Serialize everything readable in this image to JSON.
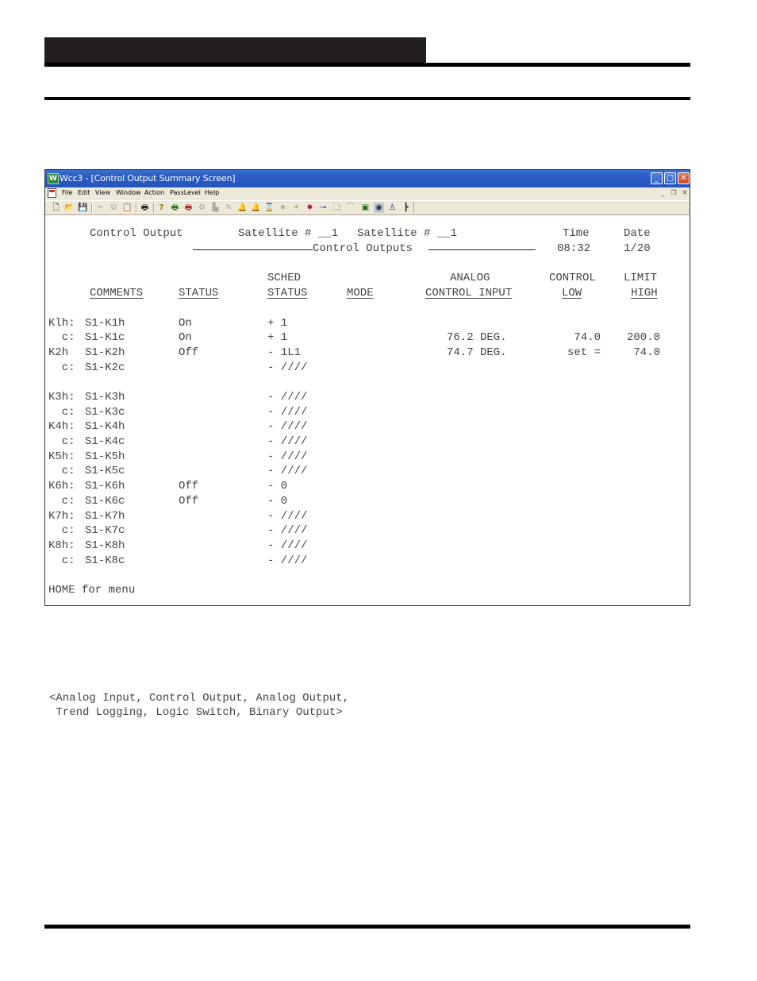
{
  "page": {
    "header_block_text": "",
    "note_lines": [
      "<Analog Input, Control Output, Analog Output,",
      " Trend Logging, Logic Switch, Binary Output>"
    ]
  },
  "window": {
    "title": "Wcc3 - [Control Output Summary Screen]",
    "app_icon": "W",
    "controls": {
      "minimize": "_",
      "maximize": "□",
      "close": "✕"
    },
    "menu": [
      "File",
      "Edit",
      "View",
      "Window",
      "Action",
      "PassLevel",
      "Help"
    ],
    "mdi_controls": {
      "minimize": "_",
      "restore": "❐",
      "close": "✕"
    },
    "toolbar": [
      {
        "name": "new-icon",
        "glyph": "🗋",
        "enabled": true
      },
      {
        "name": "open-icon",
        "glyph": "📂",
        "enabled": true
      },
      {
        "name": "save-icon",
        "glyph": "💾",
        "enabled": true
      },
      {
        "name": "cut-icon",
        "glyph": "✂",
        "enabled": false
      },
      {
        "name": "copy-icon",
        "glyph": "⧉",
        "enabled": false
      },
      {
        "name": "paste-icon",
        "glyph": "📋",
        "enabled": false
      },
      {
        "name": "print-icon",
        "glyph": "🖶",
        "enabled": true
      },
      {
        "name": "help-icon",
        "glyph": "?",
        "enabled": true
      },
      {
        "name": "print-setup-icon",
        "glyph": "🖶",
        "enabled": true
      },
      {
        "name": "print-red-icon",
        "glyph": "🖶",
        "enabled": true
      },
      {
        "name": "network-icon",
        "glyph": "⚙",
        "enabled": false
      },
      {
        "name": "folder-icon",
        "glyph": "▙",
        "enabled": false
      },
      {
        "name": "edit-icon",
        "glyph": "✎",
        "enabled": false
      },
      {
        "name": "alarm-bell-icon",
        "glyph": "🔔",
        "enabled": false
      },
      {
        "name": "bell-icon",
        "glyph": "🔔",
        "enabled": false
      },
      {
        "name": "hourglass-icon",
        "glyph": "⌛",
        "enabled": false
      },
      {
        "name": "star-icon",
        "glyph": "★",
        "enabled": false
      },
      {
        "name": "sparkle-icon",
        "glyph": "✶",
        "enabled": false
      },
      {
        "name": "badge-icon",
        "glyph": "✹",
        "enabled": true
      },
      {
        "name": "key-icon",
        "glyph": "⊸",
        "enabled": true
      },
      {
        "name": "pages-icon",
        "glyph": "❏",
        "enabled": false
      },
      {
        "name": "chart-icon",
        "glyph": "⌒",
        "enabled": false
      },
      {
        "name": "display-icon",
        "glyph": "▣",
        "enabled": true
      },
      {
        "name": "eye-icon",
        "glyph": "◉",
        "enabled": true
      },
      {
        "name": "users-icon",
        "glyph": "♙",
        "enabled": true
      },
      {
        "name": "tree-icon",
        "glyph": "┣",
        "enabled": true
      }
    ]
  },
  "screen": {
    "title": "Control Output",
    "satellite_label_1": "Satellite # __1",
    "satellite_label_2": "Satellite # __1",
    "section_title": "Control Outputs",
    "time_label": "Time",
    "time_value": "08:32",
    "date_label": "Date",
    "date_value": "1/20",
    "headers": {
      "comments": "COMMENTS",
      "status": "STATUS",
      "sched_top": "SCHED",
      "sched": "STATUS",
      "mode": "MODE",
      "analog_top": "ANALOG",
      "analog": "CONTROL INPUT",
      "control_top": "CONTROL",
      "low": "LOW",
      "limit_top": "LIMIT",
      "high": "HIGH"
    },
    "rows": [
      {
        "id": "Klh:",
        "comment": "S1-K1h",
        "status": "On",
        "sched": "+ 1",
        "analog": "",
        "low": "",
        "high": ""
      },
      {
        "id": "  c:",
        "comment": "S1-K1c",
        "status": "On",
        "sched": "+ 1",
        "analog": "76.2 DEG.",
        "low": "74.0",
        "high": "200.0"
      },
      {
        "id": "K2h ",
        "comment": "S1-K2h",
        "status": "Off",
        "sched": "- 1L1",
        "analog": "74.7 DEG.",
        "low": "set =",
        "high": "74.0"
      },
      {
        "id": "  c:",
        "comment": "S1-K2c",
        "status": "",
        "sched": "- ////",
        "analog": "",
        "low": "",
        "high": ""
      },
      {
        "id": "K3h:",
        "comment": "S1-K3h",
        "status": "",
        "sched": "- ////",
        "analog": "",
        "low": "",
        "high": ""
      },
      {
        "id": "  c:",
        "comment": "S1-K3c",
        "status": "",
        "sched": "- ////",
        "analog": "",
        "low": "",
        "high": ""
      },
      {
        "id": "K4h:",
        "comment": "S1-K4h",
        "status": "",
        "sched": "- ////",
        "analog": "",
        "low": "",
        "high": ""
      },
      {
        "id": "  c:",
        "comment": "S1-K4c",
        "status": "",
        "sched": "- ////",
        "analog": "",
        "low": "",
        "high": ""
      },
      {
        "id": "K5h:",
        "comment": "S1-K5h",
        "status": "",
        "sched": "- ////",
        "analog": "",
        "low": "",
        "high": ""
      },
      {
        "id": "  c:",
        "comment": "S1-K5c",
        "status": "",
        "sched": "- ////",
        "analog": "",
        "low": "",
        "high": ""
      },
      {
        "id": "K6h:",
        "comment": "S1-K6h",
        "status": "Off",
        "sched": "- 0",
        "analog": "",
        "low": "",
        "high": ""
      },
      {
        "id": "  c:",
        "comment": "S1-K6c",
        "status": "Off",
        "sched": "- 0",
        "analog": "",
        "low": "",
        "high": ""
      },
      {
        "id": "K7h:",
        "comment": "S1-K7h",
        "status": "",
        "sched": "- ////",
        "analog": "",
        "low": "",
        "high": ""
      },
      {
        "id": "  c:",
        "comment": "S1-K7c",
        "status": "",
        "sched": "- ////",
        "analog": "",
        "low": "",
        "high": ""
      },
      {
        "id": "K8h:",
        "comment": "S1-K8h",
        "status": "",
        "sched": "- ////",
        "analog": "",
        "low": "",
        "high": ""
      },
      {
        "id": "  c:",
        "comment": "S1-K8c",
        "status": "",
        "sched": "- ////",
        "analog": "",
        "low": "",
        "high": ""
      }
    ],
    "footer": "HOME for menu"
  }
}
